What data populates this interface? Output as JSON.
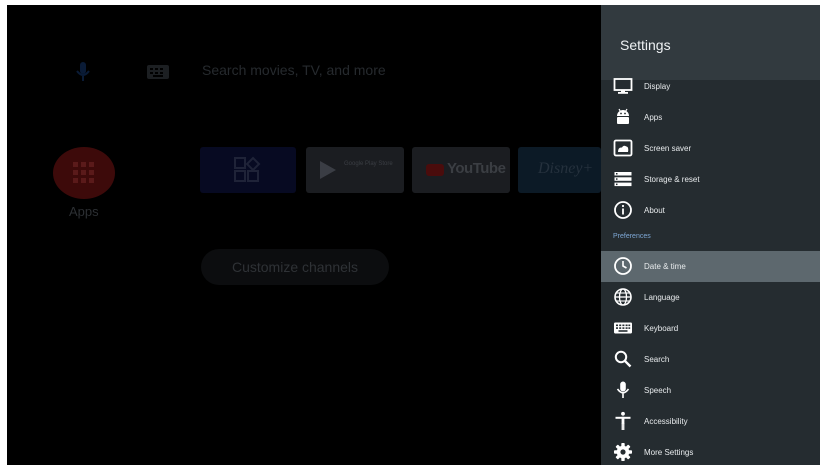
{
  "launcher": {
    "search_placeholder": "Search movies, TV, and more",
    "apps_label": "Apps",
    "tiles": {
      "google_play": "Google Play Store",
      "youtube": "YouTube",
      "disney": "Disney+"
    },
    "customize_label": "Customize channels"
  },
  "settings": {
    "title": "Settings",
    "section_label": "Preferences",
    "items": [
      {
        "label": "Display",
        "icon": "monitor-icon"
      },
      {
        "label": "Apps",
        "icon": "android-icon"
      },
      {
        "label": "Screen saver",
        "icon": "screensaver-icon"
      },
      {
        "label": "Storage & reset",
        "icon": "storage-icon"
      },
      {
        "label": "About",
        "icon": "info-icon"
      },
      {
        "label": "Date & time",
        "icon": "clock-icon",
        "selected": true
      },
      {
        "label": "Language",
        "icon": "globe-icon"
      },
      {
        "label": "Keyboard",
        "icon": "keyboard-icon"
      },
      {
        "label": "Search",
        "icon": "search-icon"
      },
      {
        "label": "Speech",
        "icon": "microphone-icon"
      },
      {
        "label": "Accessibility",
        "icon": "accessibility-icon"
      },
      {
        "label": "More Settings",
        "icon": "gear-icon"
      }
    ]
  },
  "colors": {
    "panel_bg": "#252c30",
    "panel_header_bg": "#323a3f",
    "selected_row": "#5d686e",
    "section_label": "#7ea8d6"
  }
}
